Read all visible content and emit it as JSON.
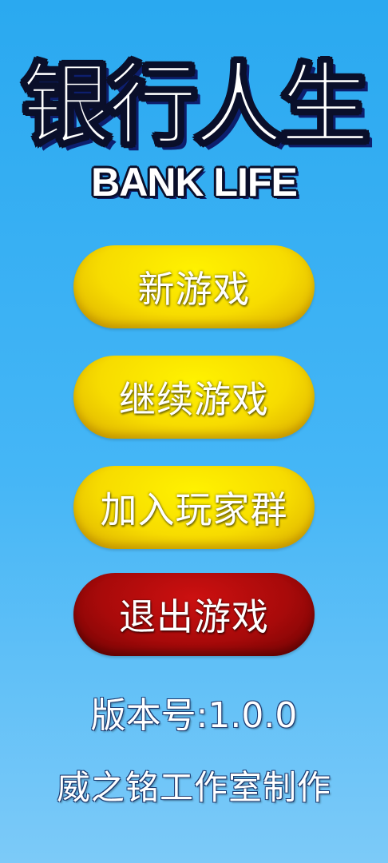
{
  "title": {
    "chinese": "银行人生",
    "english": "BANK LIFE"
  },
  "menu": {
    "new_game": "新游戏",
    "continue_game": "继续游戏",
    "join_group": "加入玩家群",
    "exit_game": "退出游戏"
  },
  "footer": {
    "version": "版本号:1.0.0",
    "studio": "威之铭工作室制作"
  },
  "colors": {
    "background": "#2aa9f0",
    "button_primary": "#f7dc00",
    "button_exit": "#a80a0a",
    "text": "#ffffff",
    "outline": "#0a0f2a"
  }
}
